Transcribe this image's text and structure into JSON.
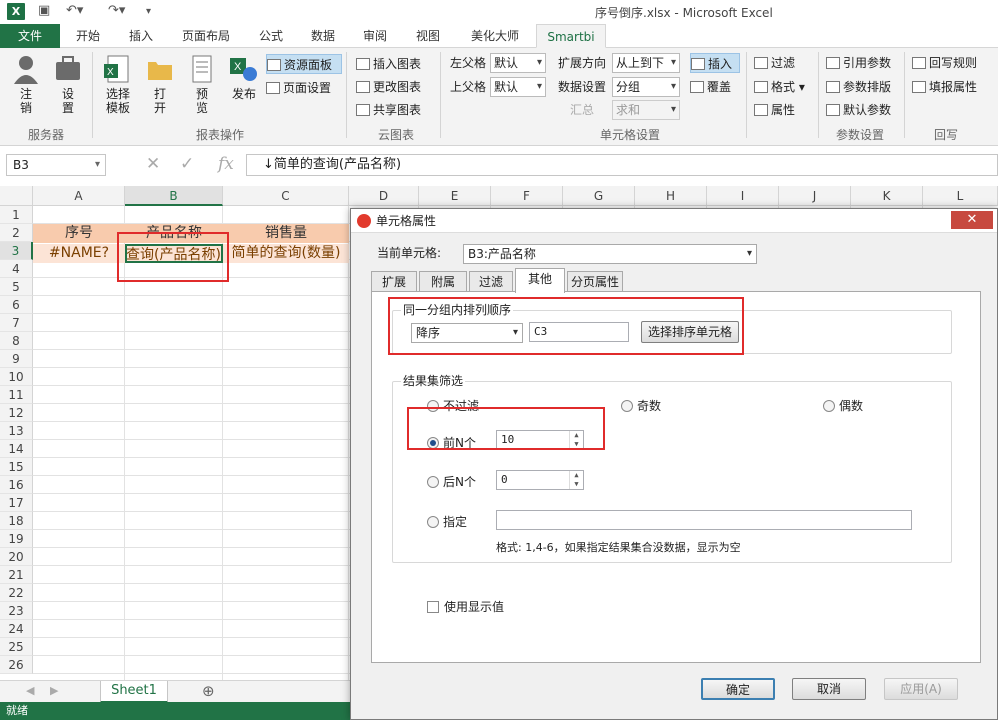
{
  "window": {
    "title": "序号倒序.xlsx - Microsoft Excel",
    "app_logo": "X"
  },
  "ribbon_tabs": [
    "文件",
    "开始",
    "插入",
    "页面布局",
    "公式",
    "数据",
    "审阅",
    "视图",
    "美化大师",
    "Smartbi"
  ],
  "ribbon": {
    "server": {
      "logout": "注\n销",
      "settings": "设\n置",
      "group": "服务器"
    },
    "report": {
      "choose_template": "选择\n模板",
      "open": "打\n开",
      "preview": "预\n览",
      "publish": "发布",
      "resource_panel": "资源面板",
      "page_setup": "页面设置",
      "group": "报表操作"
    },
    "cloud_chart": {
      "insert_chart": "插入图表",
      "change_chart": "更改图表",
      "share_chart": "共享图表",
      "group": "云图表"
    },
    "cell_settings": {
      "left_parent": "左父格",
      "top_parent": "上父格",
      "left_parent_value": "默认",
      "top_parent_value": "默认",
      "expand_dir_label": "扩展方向",
      "expand_dir_value": "从上到下",
      "data_setting_label": "数据设置",
      "data_setting_value": "分组",
      "summary_label": "汇总",
      "summary_value": "求和",
      "insert": "插入",
      "override": "覆盖",
      "group": "单元格设置"
    },
    "filter": {
      "filter": "过滤",
      "format": "格式",
      "attributes": "属性"
    },
    "params": {
      "ref_param": "引用参数",
      "param_layout": "参数排版",
      "default_param": "默认参数",
      "group": "参数设置"
    },
    "writeback": {
      "writeback_rule": "回写规则",
      "fill_attr": "填报属性",
      "group": "回写"
    }
  },
  "formula_bar": {
    "name_box": "B3",
    "formula": "简单的查询(产品名称)"
  },
  "sheet": {
    "columns": [
      "A",
      "B",
      "C",
      "D",
      "E",
      "F",
      "G",
      "H",
      "I",
      "J",
      "K",
      "L"
    ],
    "rows": [
      "1",
      "2",
      "3",
      "4",
      "5",
      "6",
      "7",
      "8",
      "9",
      "10",
      "11",
      "12",
      "13",
      "14",
      "15",
      "16",
      "17",
      "18",
      "19",
      "20",
      "21",
      "22",
      "23",
      "24",
      "25",
      "26"
    ],
    "header_row": [
      "序号",
      "产品名称",
      "销售量"
    ],
    "data_row": [
      "#NAME?",
      "简单的查询(产品名称)",
      "简单的查询(数量)"
    ],
    "tab": "Sheet1",
    "status": "就绪"
  },
  "dialog": {
    "title": "单元格属性",
    "current_cell_label": "当前单元格:",
    "current_cell_value": "B3:产品名称",
    "tabs": [
      "扩展",
      "附属",
      "过滤",
      "其他",
      "分页属性"
    ],
    "sort_group": {
      "title": "同一分组内排列顺序",
      "order": "降序",
      "sort_cell": "C3",
      "choose_button": "选择排序单元格"
    },
    "filter_group": {
      "title": "结果集筛选",
      "no_filter": "不过滤",
      "odd": "奇数",
      "even": "偶数",
      "top_n": "前N个",
      "top_n_value": "10",
      "bottom_n": "后N个",
      "bottom_n_value": "0",
      "specify": "指定",
      "specify_value": "",
      "format_hint": "格式: 1,4-6，如果指定结果集合没数据，显示为空"
    },
    "use_display_value": "使用显示值",
    "ok": "确定",
    "cancel": "取消",
    "apply": "应用(A)"
  },
  "colors": {
    "excel_green": "#217346",
    "header_fill": "#f8cbad",
    "data_fill": "#fce4d6",
    "highlight_red": "#e02b2b"
  }
}
